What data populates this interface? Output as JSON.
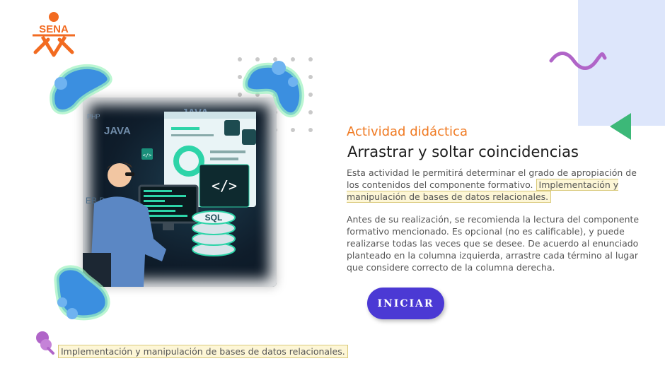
{
  "logo": {
    "text": "SENA",
    "color": "#f26b21"
  },
  "activity": {
    "kicker": "Actividad didáctica",
    "title": "Arrastrar y soltar coincidencias",
    "paragraph1": "Esta actividad le permitirá determinar el grado de apropiación de los contenidos del componente formativo.",
    "component_name": "Implementación y manipulación de bases de datos relacionales.",
    "paragraph2": "Antes de su realización, se recomienda la lectura del componente formativo mencionado.  Es opcional (no es calificable), y puede realizarse todas las veces que se desee.  De acuerdo al enunciado planteado en la columna izquierda, arrastre cada término al lugar que considere correcto de la columna derecha.",
    "start_label": "INICIAR"
  },
  "illustration": {
    "labels": [
      "JAVA",
      "JAVA",
      "PHP",
      "SQL",
      "</>",
      "</>",
      "EB D"
    ]
  },
  "footer": {
    "text": "Implementación y manipulación de bases de datos relacionales."
  },
  "colors": {
    "accent_orange": "#f07a22",
    "button_purple": "#4b39d4",
    "blob_blue": "#3b8fe0",
    "blob_glow": "#8ff0b0",
    "wave_purple": "#b065c8",
    "triangle_green": "#3cb878",
    "panel_blue": "#dde6fb"
  },
  "icons": [
    "sena-logo-icon",
    "blob-decor-icon",
    "wave-decor-icon",
    "triangle-decor-icon",
    "dot-grid-icon",
    "pushpin-icon"
  ]
}
